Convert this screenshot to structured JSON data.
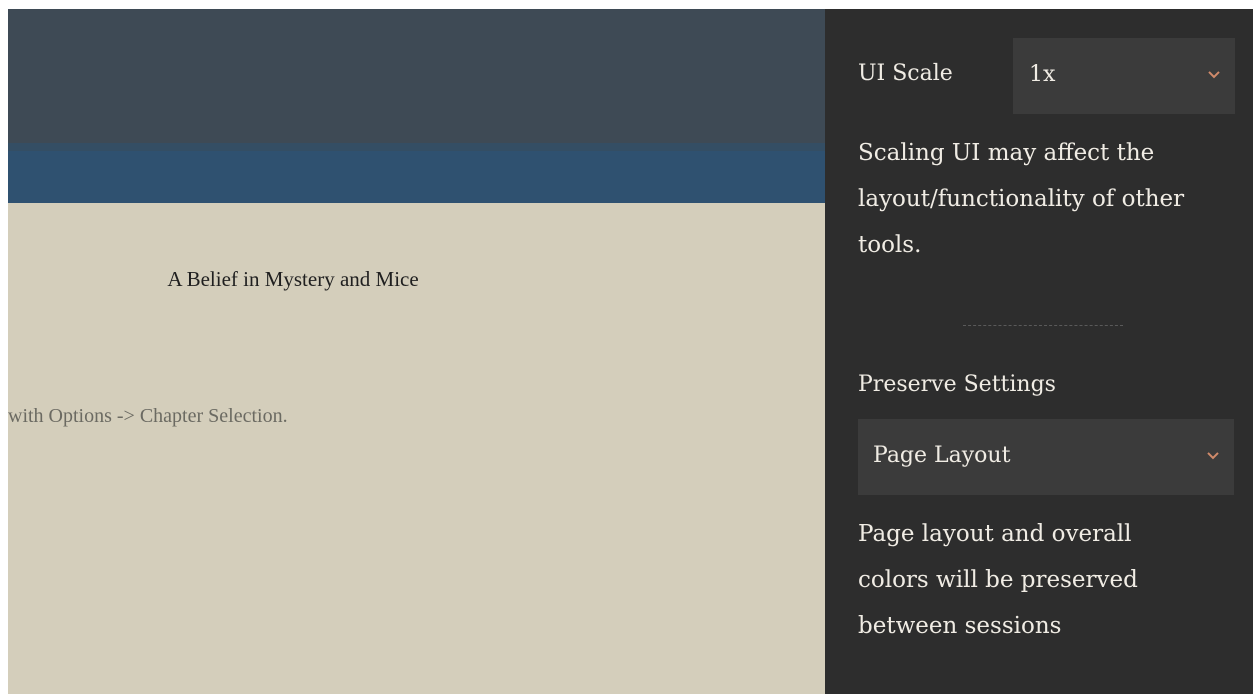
{
  "reader": {
    "chapter_title": "A Belief in Mystery and Mice",
    "hint_text": "with Options -> Chapter Selection."
  },
  "settings": {
    "ui_scale": {
      "label": "UI Scale",
      "value": "1x",
      "icon": "chevron-down-icon",
      "description": "Scaling UI may affect the layout/functionality of other tools."
    },
    "preserve": {
      "label": "Preserve Settings",
      "value": "Page Layout",
      "icon": "chevron-down-icon",
      "description": "Page layout and overall colors will be preserved between sessions"
    }
  },
  "colors": {
    "panel_bg": "#2d2d2d",
    "select_bg": "#3b3b3b",
    "chevron": "#d08a6a",
    "page_bg": "#d4cebb",
    "header_dark": "#3e4a55",
    "header_blue": "#2f5170"
  }
}
